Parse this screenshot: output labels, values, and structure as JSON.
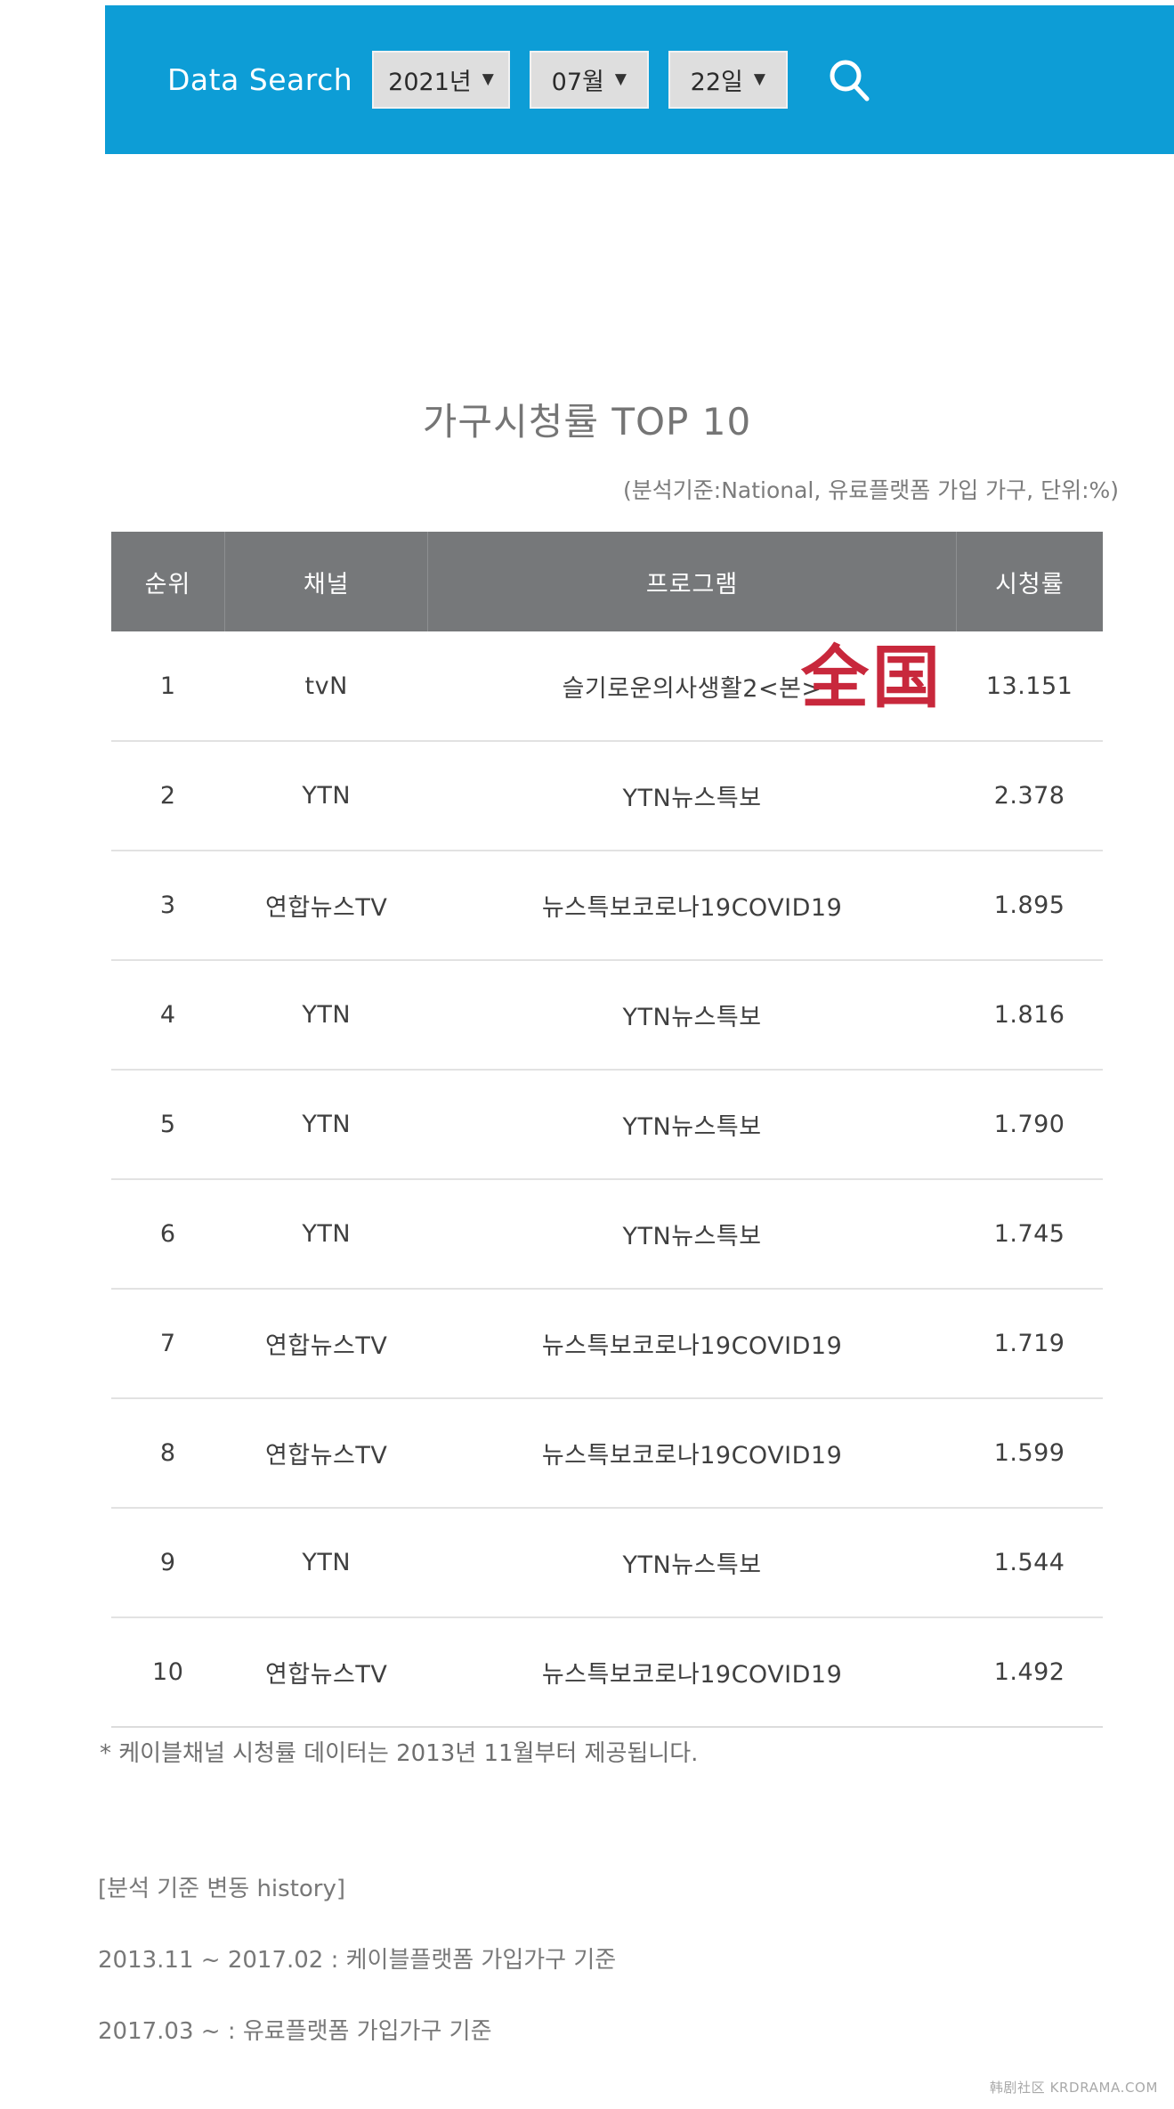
{
  "search_bar": {
    "label": "Data Search",
    "accent_color": "#0d9dd6",
    "year": {
      "value": "2021년",
      "caret": "▼"
    },
    "month": {
      "value": "07월",
      "caret": "▼"
    },
    "day": {
      "value": "22일",
      "caret": "▼"
    },
    "search_icon": "search-icon"
  },
  "title": {
    "heading": "가구시청률 TOP 10",
    "subtitle": "(분석기준:National, 유료플랫폼 가입 가구, 단위:%)"
  },
  "table": {
    "header_bg": "#76787a",
    "rating_color": "#1b8db3",
    "columns": [
      "순위",
      "채널",
      "프로그램",
      "시청률"
    ],
    "rows": [
      {
        "rank": "1",
        "channel": "tvN",
        "program": "슬기로운의사생활2<본>",
        "rating": "13.151"
      },
      {
        "rank": "2",
        "channel": "YTN",
        "program": "YTN뉴스특보",
        "rating": "2.378"
      },
      {
        "rank": "3",
        "channel": "연합뉴스TV",
        "program": "뉴스특보코로나19COVID19",
        "rating": "1.895"
      },
      {
        "rank": "4",
        "channel": "YTN",
        "program": "YTN뉴스특보",
        "rating": "1.816"
      },
      {
        "rank": "5",
        "channel": "YTN",
        "program": "YTN뉴스특보",
        "rating": "1.790"
      },
      {
        "rank": "6",
        "channel": "YTN",
        "program": "YTN뉴스특보",
        "rating": "1.745"
      },
      {
        "rank": "7",
        "channel": "연합뉴스TV",
        "program": "뉴스특보코로나19COVID19",
        "rating": "1.719"
      },
      {
        "rank": "8",
        "channel": "연합뉴스TV",
        "program": "뉴스특보코로나19COVID19",
        "rating": "1.599"
      },
      {
        "rank": "9",
        "channel": "YTN",
        "program": "YTN뉴스특보",
        "rating": "1.544"
      },
      {
        "rank": "10",
        "channel": "연합뉴스TV",
        "program": "뉴스특보코로나19COVID19",
        "rating": "1.492"
      }
    ]
  },
  "stamp": {
    "text": "全国",
    "color": "#c8283c"
  },
  "footnote": "* 케이블채널 시청률 데이터는 2013년 11월부터 제공됩니다.",
  "history": {
    "heading": "[분석 기준 변동 history]",
    "lines": [
      "2013.11 ~ 2017.02 : 케이블플랫폼 가입가구 기준",
      "2017.03 ~ : 유료플랫폼 가입가구 기준"
    ]
  },
  "watermark": "韩剧社区 KRDRAMA.COM",
  "chart_data": {
    "type": "table",
    "title": "가구시청률 TOP 10",
    "subtitle": "(분석기준:National, 유료플랫폼 가입 가구, 단위:%)",
    "columns": [
      "순위",
      "채널",
      "프로그램",
      "시청률"
    ],
    "categories": [
      "슬기로운의사생활2<본>",
      "YTN뉴스특보",
      "뉴스특보코로나19COVID19",
      "YTN뉴스특보",
      "YTN뉴스특보",
      "YTN뉴스특보",
      "뉴스특보코로나19COVID19",
      "뉴스특보코로나19COVID19",
      "YTN뉴스특보",
      "뉴스특보코로나19COVID19"
    ],
    "values": [
      13.151,
      2.378,
      1.895,
      1.816,
      1.79,
      1.745,
      1.719,
      1.599,
      1.544,
      1.492
    ],
    "ylabel": "시청률 (%)",
    "xlabel": "프로그램",
    "ylim": [
      0,
      14
    ]
  }
}
